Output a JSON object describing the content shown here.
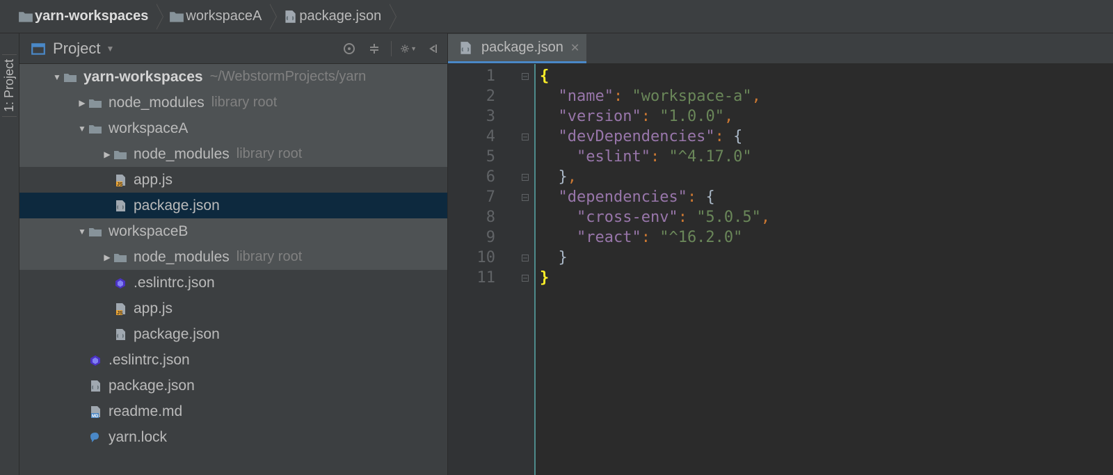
{
  "breadcrumb": {
    "items": [
      {
        "label": "yarn-workspaces",
        "icon": "folder"
      },
      {
        "label": "workspaceA",
        "icon": "folder"
      },
      {
        "label": "package.json",
        "icon": "json"
      }
    ]
  },
  "toolStrip": {
    "label": "1: Project"
  },
  "projectPanel": {
    "title": "Project",
    "toolbar": {
      "target": "scroll-from-source",
      "collapse": "collapse-all",
      "settings": "settings",
      "hide": "hide"
    }
  },
  "tree": {
    "rows": [
      {
        "indent": 0,
        "arrow": "down",
        "icon": "folder",
        "label": "yarn-workspaces",
        "bold": true,
        "path": "~/WebstormProjects/yarn",
        "style": "highlighted"
      },
      {
        "indent": 1,
        "arrow": "right",
        "icon": "folder",
        "label": "node_modules",
        "suffix": "library root",
        "style": "highlighted"
      },
      {
        "indent": 1,
        "arrow": "down",
        "icon": "folder",
        "label": "workspaceA",
        "style": "highlighted"
      },
      {
        "indent": 2,
        "arrow": "right",
        "icon": "folder",
        "label": "node_modules",
        "suffix": "library root",
        "style": "highlighted"
      },
      {
        "indent": 2,
        "arrow": "",
        "icon": "js",
        "label": "app.js"
      },
      {
        "indent": 2,
        "arrow": "",
        "icon": "json",
        "label": "package.json",
        "style": "selected"
      },
      {
        "indent": 1,
        "arrow": "down",
        "icon": "folder",
        "label": "workspaceB",
        "style": "highlighted"
      },
      {
        "indent": 2,
        "arrow": "right",
        "icon": "folder",
        "label": "node_modules",
        "suffix": "library root",
        "style": "highlighted"
      },
      {
        "indent": 2,
        "arrow": "",
        "icon": "eslint",
        "label": ".eslintrc.json"
      },
      {
        "indent": 2,
        "arrow": "",
        "icon": "js",
        "label": "app.js"
      },
      {
        "indent": 2,
        "arrow": "",
        "icon": "json",
        "label": "package.json"
      },
      {
        "indent": 1,
        "arrow": "",
        "icon": "eslint",
        "label": ".eslintrc.json"
      },
      {
        "indent": 1,
        "arrow": "",
        "icon": "json",
        "label": "package.json"
      },
      {
        "indent": 1,
        "arrow": "",
        "icon": "md",
        "label": "readme.md"
      },
      {
        "indent": 1,
        "arrow": "",
        "icon": "lock",
        "label": "yarn.lock"
      }
    ]
  },
  "editor": {
    "tab": {
      "label": "package.json"
    },
    "lineNumbers": [
      "1",
      "2",
      "3",
      "4",
      "5",
      "6",
      "7",
      "8",
      "9",
      "10",
      "11"
    ],
    "foldMarks": [
      "open",
      "",
      "",
      "open",
      "",
      "close",
      "open",
      "",
      "",
      "close",
      "close"
    ],
    "code": {
      "name_key": "\"name\"",
      "name_val": "\"workspace-a\"",
      "version_key": "\"version\"",
      "version_val": "\"1.0.0\"",
      "devdep_key": "\"devDependencies\"",
      "eslint_key": "\"eslint\"",
      "eslint_val": "\"^4.17.0\"",
      "dep_key": "\"dependencies\"",
      "crossenv_key": "\"cross-env\"",
      "crossenv_val": "\"5.0.5\"",
      "react_key": "\"react\"",
      "react_val": "\"^16.2.0\""
    }
  }
}
